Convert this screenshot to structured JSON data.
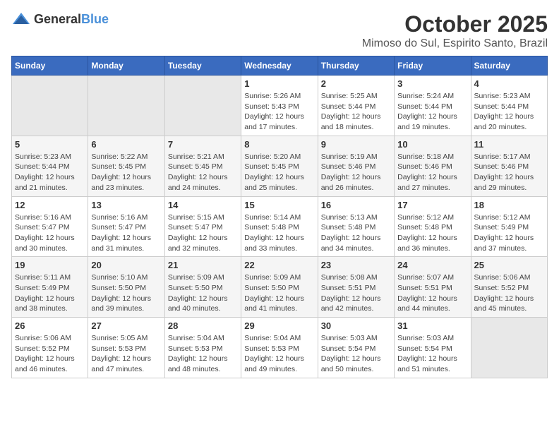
{
  "logo": {
    "text_general": "General",
    "text_blue": "Blue"
  },
  "header": {
    "month": "October 2025",
    "location": "Mimoso do Sul, Espirito Santo, Brazil"
  },
  "weekdays": [
    "Sunday",
    "Monday",
    "Tuesday",
    "Wednesday",
    "Thursday",
    "Friday",
    "Saturday"
  ],
  "weeks": [
    [
      {
        "day": "",
        "info": ""
      },
      {
        "day": "",
        "info": ""
      },
      {
        "day": "",
        "info": ""
      },
      {
        "day": "1",
        "info": "Sunrise: 5:26 AM\nSunset: 5:43 PM\nDaylight: 12 hours and 17 minutes."
      },
      {
        "day": "2",
        "info": "Sunrise: 5:25 AM\nSunset: 5:44 PM\nDaylight: 12 hours and 18 minutes."
      },
      {
        "day": "3",
        "info": "Sunrise: 5:24 AM\nSunset: 5:44 PM\nDaylight: 12 hours and 19 minutes."
      },
      {
        "day": "4",
        "info": "Sunrise: 5:23 AM\nSunset: 5:44 PM\nDaylight: 12 hours and 20 minutes."
      }
    ],
    [
      {
        "day": "5",
        "info": "Sunrise: 5:23 AM\nSunset: 5:44 PM\nDaylight: 12 hours and 21 minutes."
      },
      {
        "day": "6",
        "info": "Sunrise: 5:22 AM\nSunset: 5:45 PM\nDaylight: 12 hours and 23 minutes."
      },
      {
        "day": "7",
        "info": "Sunrise: 5:21 AM\nSunset: 5:45 PM\nDaylight: 12 hours and 24 minutes."
      },
      {
        "day": "8",
        "info": "Sunrise: 5:20 AM\nSunset: 5:45 PM\nDaylight: 12 hours and 25 minutes."
      },
      {
        "day": "9",
        "info": "Sunrise: 5:19 AM\nSunset: 5:46 PM\nDaylight: 12 hours and 26 minutes."
      },
      {
        "day": "10",
        "info": "Sunrise: 5:18 AM\nSunset: 5:46 PM\nDaylight: 12 hours and 27 minutes."
      },
      {
        "day": "11",
        "info": "Sunrise: 5:17 AM\nSunset: 5:46 PM\nDaylight: 12 hours and 29 minutes."
      }
    ],
    [
      {
        "day": "12",
        "info": "Sunrise: 5:16 AM\nSunset: 5:47 PM\nDaylight: 12 hours and 30 minutes."
      },
      {
        "day": "13",
        "info": "Sunrise: 5:16 AM\nSunset: 5:47 PM\nDaylight: 12 hours and 31 minutes."
      },
      {
        "day": "14",
        "info": "Sunrise: 5:15 AM\nSunset: 5:47 PM\nDaylight: 12 hours and 32 minutes."
      },
      {
        "day": "15",
        "info": "Sunrise: 5:14 AM\nSunset: 5:48 PM\nDaylight: 12 hours and 33 minutes."
      },
      {
        "day": "16",
        "info": "Sunrise: 5:13 AM\nSunset: 5:48 PM\nDaylight: 12 hours and 34 minutes."
      },
      {
        "day": "17",
        "info": "Sunrise: 5:12 AM\nSunset: 5:48 PM\nDaylight: 12 hours and 36 minutes."
      },
      {
        "day": "18",
        "info": "Sunrise: 5:12 AM\nSunset: 5:49 PM\nDaylight: 12 hours and 37 minutes."
      }
    ],
    [
      {
        "day": "19",
        "info": "Sunrise: 5:11 AM\nSunset: 5:49 PM\nDaylight: 12 hours and 38 minutes."
      },
      {
        "day": "20",
        "info": "Sunrise: 5:10 AM\nSunset: 5:50 PM\nDaylight: 12 hours and 39 minutes."
      },
      {
        "day": "21",
        "info": "Sunrise: 5:09 AM\nSunset: 5:50 PM\nDaylight: 12 hours and 40 minutes."
      },
      {
        "day": "22",
        "info": "Sunrise: 5:09 AM\nSunset: 5:50 PM\nDaylight: 12 hours and 41 minutes."
      },
      {
        "day": "23",
        "info": "Sunrise: 5:08 AM\nSunset: 5:51 PM\nDaylight: 12 hours and 42 minutes."
      },
      {
        "day": "24",
        "info": "Sunrise: 5:07 AM\nSunset: 5:51 PM\nDaylight: 12 hours and 44 minutes."
      },
      {
        "day": "25",
        "info": "Sunrise: 5:06 AM\nSunset: 5:52 PM\nDaylight: 12 hours and 45 minutes."
      }
    ],
    [
      {
        "day": "26",
        "info": "Sunrise: 5:06 AM\nSunset: 5:52 PM\nDaylight: 12 hours and 46 minutes."
      },
      {
        "day": "27",
        "info": "Sunrise: 5:05 AM\nSunset: 5:53 PM\nDaylight: 12 hours and 47 minutes."
      },
      {
        "day": "28",
        "info": "Sunrise: 5:04 AM\nSunset: 5:53 PM\nDaylight: 12 hours and 48 minutes."
      },
      {
        "day": "29",
        "info": "Sunrise: 5:04 AM\nSunset: 5:53 PM\nDaylight: 12 hours and 49 minutes."
      },
      {
        "day": "30",
        "info": "Sunrise: 5:03 AM\nSunset: 5:54 PM\nDaylight: 12 hours and 50 minutes."
      },
      {
        "day": "31",
        "info": "Sunrise: 5:03 AM\nSunset: 5:54 PM\nDaylight: 12 hours and 51 minutes."
      },
      {
        "day": "",
        "info": ""
      }
    ]
  ]
}
